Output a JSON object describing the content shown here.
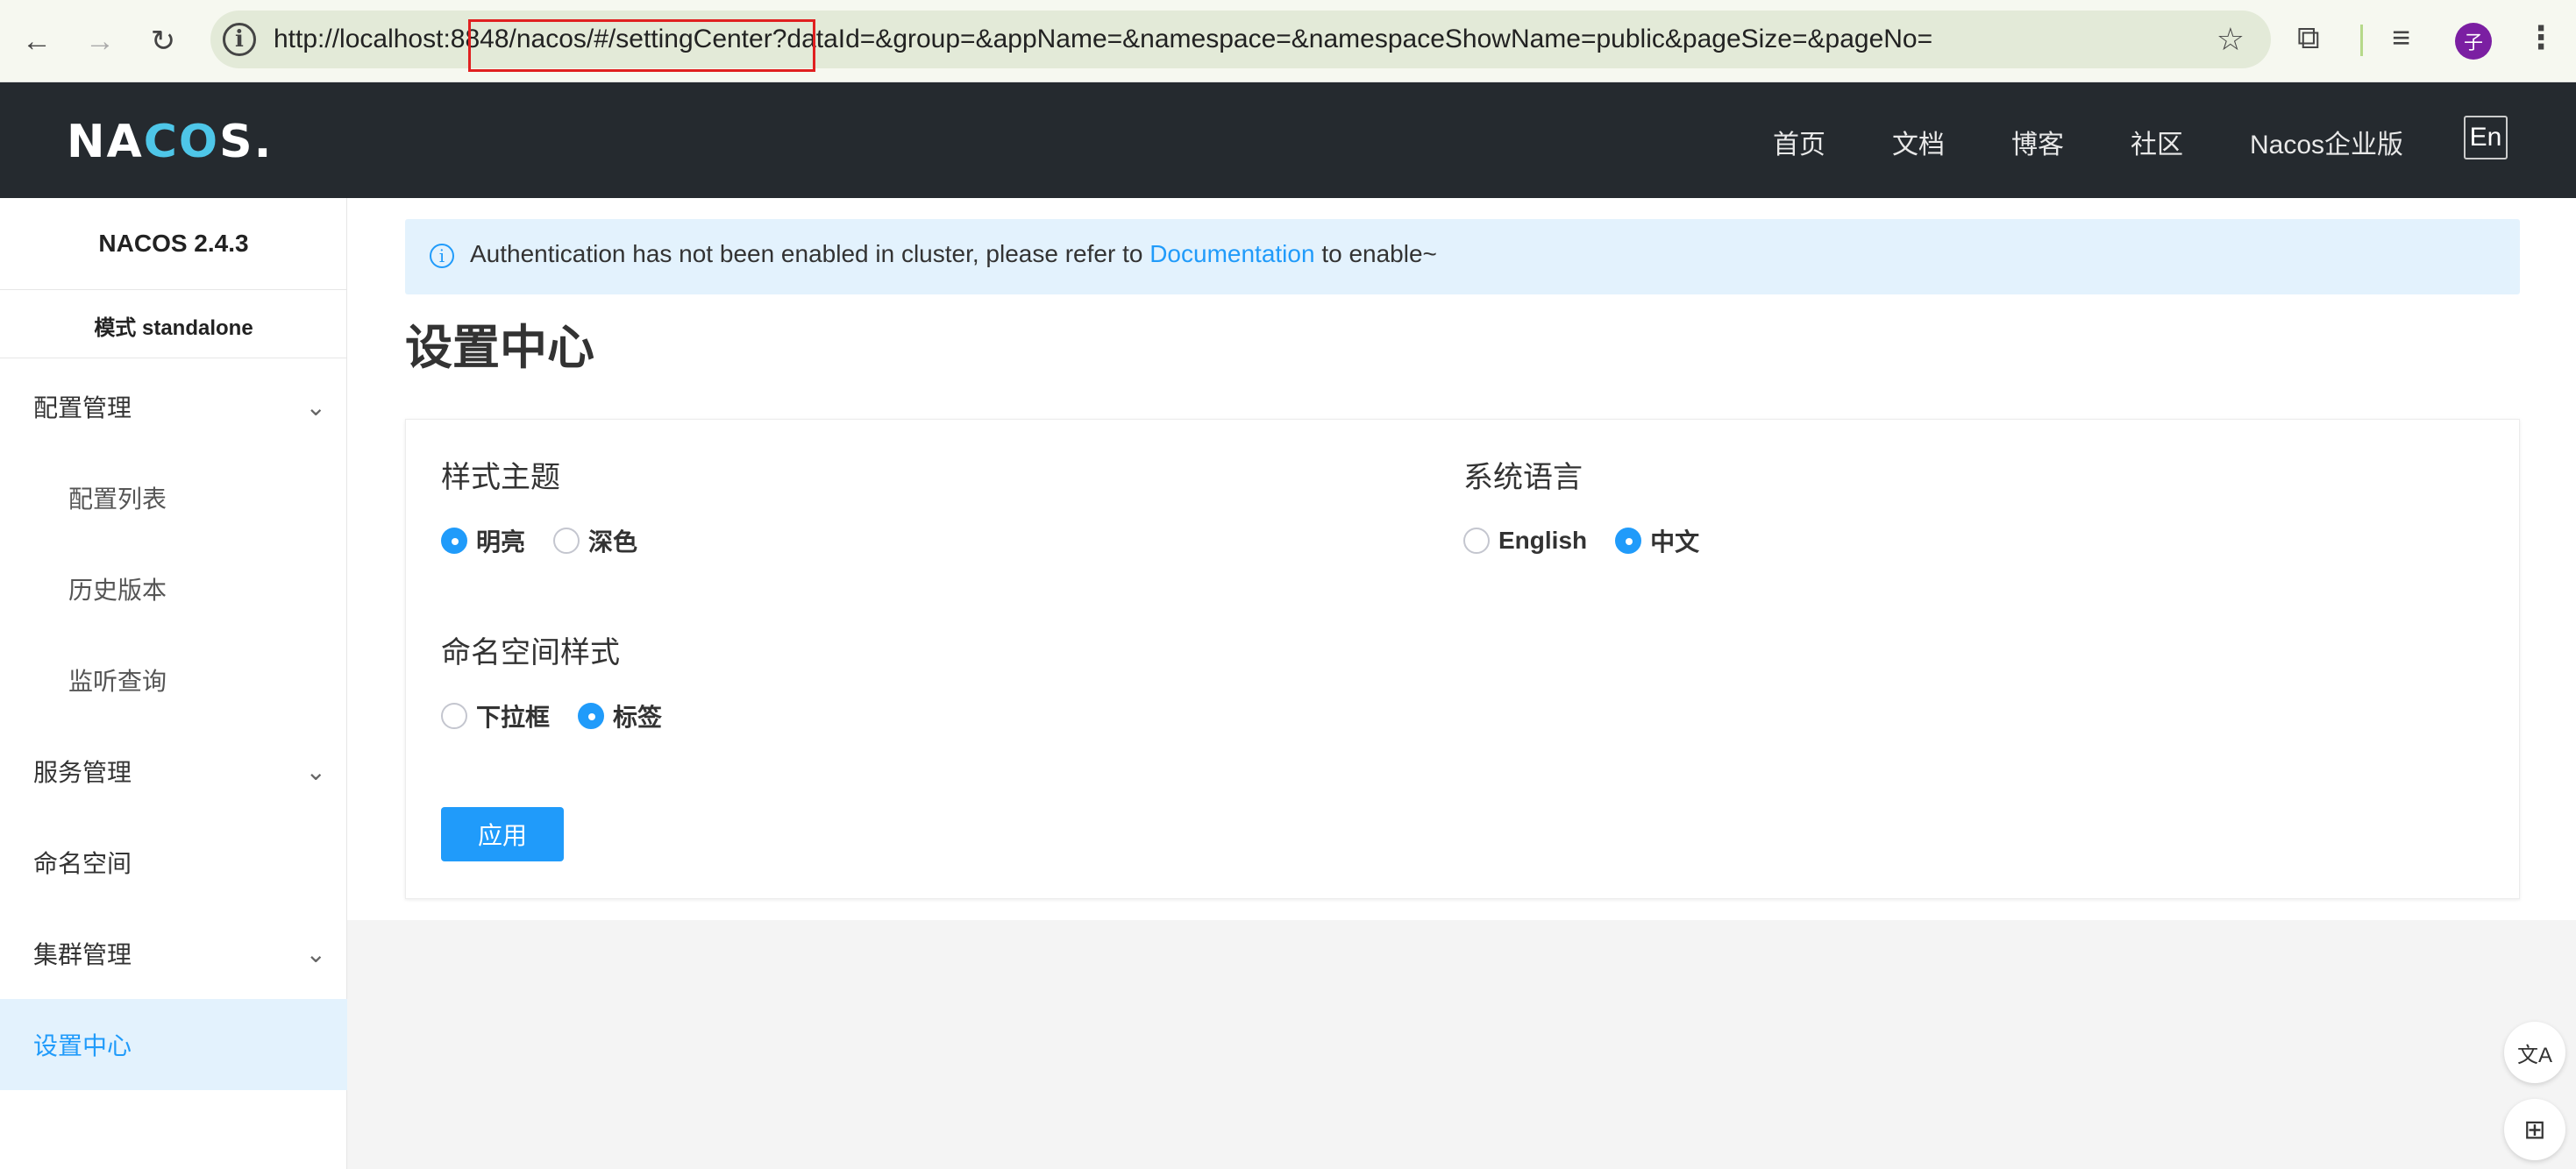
{
  "browser": {
    "back_icon": "←",
    "forward_icon": "→",
    "reload_icon": "↻",
    "info_icon": "i",
    "url": "http://localhost:8848/nacos/#/settingCenter?dataId=&group=&appName=&namespace=&namespaceShowName=public&pageSize=&pageNo=",
    "star_icon": "☆",
    "puzzle_icon": "⧉",
    "media_icon": "≡",
    "profile_initial": "子",
    "menu_icon": "⋮"
  },
  "topnav": {
    "logo_left": "NA",
    "logo_mid": "CO",
    "logo_right": "S.",
    "links": [
      "首页",
      "文档",
      "博客",
      "社区",
      "Nacos企业版"
    ],
    "lang_button": "En"
  },
  "sidebar": {
    "version": "NACOS 2.4.3",
    "mode": "模式 standalone",
    "chevron": "⌄",
    "items": [
      {
        "label": "配置管理"
      },
      {
        "label": "配置列表"
      },
      {
        "label": "历史版本"
      },
      {
        "label": "监听查询"
      },
      {
        "label": "服务管理"
      },
      {
        "label": "命名空间"
      },
      {
        "label": "集群管理"
      },
      {
        "label": "设置中心"
      }
    ]
  },
  "alert": {
    "icon": "i",
    "text_before": "Authentication has not been enabled in cluster, please refer to ",
    "link": "Documentation",
    "text_after": " to enable~"
  },
  "page": {
    "title": "设置中心"
  },
  "settings": {
    "theme_title": "样式主题",
    "theme_options": [
      "明亮",
      "深色"
    ],
    "theme_selected": "明亮",
    "language_title": "系统语言",
    "language_options": [
      "English",
      "中文"
    ],
    "language_selected": "中文",
    "namespace_title": "命名空间样式",
    "namespace_options": [
      "下拉框",
      "标签"
    ],
    "namespace_selected": "标签",
    "apply_label": "应用"
  },
  "floating": {
    "translate_icon": "文A",
    "apps_icon": "⊞"
  }
}
